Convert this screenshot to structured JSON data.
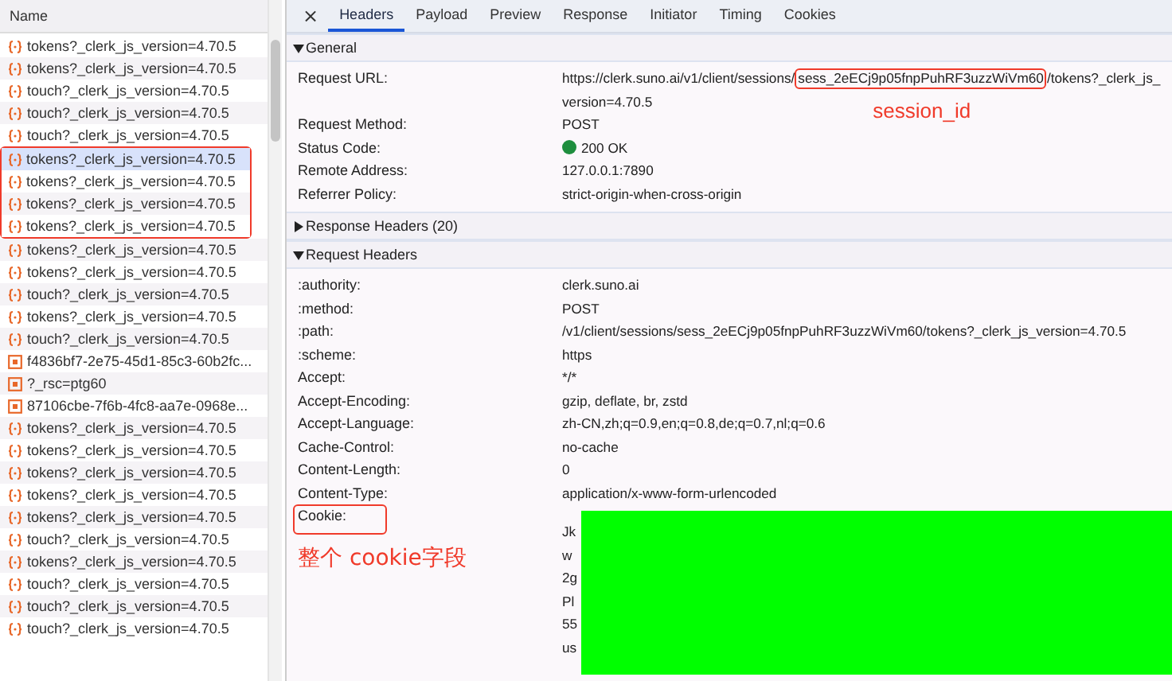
{
  "requests": {
    "column": "Name",
    "items": [
      {
        "name": "tokens?_clerk_js_version=4.70.5",
        "kind": "fetch",
        "selected": false,
        "boxed": false
      },
      {
        "name": "tokens?_clerk_js_version=4.70.5",
        "kind": "fetch",
        "selected": false,
        "boxed": false
      },
      {
        "name": "touch?_clerk_js_version=4.70.5",
        "kind": "fetch",
        "selected": false,
        "boxed": false
      },
      {
        "name": "touch?_clerk_js_version=4.70.5",
        "kind": "fetch",
        "selected": false,
        "boxed": false
      },
      {
        "name": "touch?_clerk_js_version=4.70.5",
        "kind": "fetch",
        "selected": false,
        "boxed": false
      },
      {
        "name": "tokens?_clerk_js_version=4.70.5",
        "kind": "fetch",
        "selected": true,
        "boxed": true
      },
      {
        "name": "tokens?_clerk_js_version=4.70.5",
        "kind": "fetch",
        "selected": false,
        "boxed": true
      },
      {
        "name": "tokens?_clerk_js_version=4.70.5",
        "kind": "fetch",
        "selected": false,
        "boxed": true
      },
      {
        "name": "tokens?_clerk_js_version=4.70.5",
        "kind": "fetch",
        "selected": false,
        "boxed": true
      },
      {
        "name": "tokens?_clerk_js_version=4.70.5",
        "kind": "fetch",
        "selected": false,
        "boxed": false
      },
      {
        "name": "tokens?_clerk_js_version=4.70.5",
        "kind": "fetch",
        "selected": false,
        "boxed": false
      },
      {
        "name": "touch?_clerk_js_version=4.70.5",
        "kind": "fetch",
        "selected": false,
        "boxed": false
      },
      {
        "name": "tokens?_clerk_js_version=4.70.5",
        "kind": "fetch",
        "selected": false,
        "boxed": false
      },
      {
        "name": "touch?_clerk_js_version=4.70.5",
        "kind": "fetch",
        "selected": false,
        "boxed": false
      },
      {
        "name": "f4836bf7-2e75-45d1-85c3-60b2fc...",
        "kind": "doc",
        "selected": false,
        "boxed": false
      },
      {
        "name": "?_rsc=ptg60",
        "kind": "doc",
        "selected": false,
        "boxed": false
      },
      {
        "name": "87106cbe-7f6b-4fc8-aa7e-0968e...",
        "kind": "doc",
        "selected": false,
        "boxed": false
      },
      {
        "name": "tokens?_clerk_js_version=4.70.5",
        "kind": "fetch",
        "selected": false,
        "boxed": false
      },
      {
        "name": "tokens?_clerk_js_version=4.70.5",
        "kind": "fetch",
        "selected": false,
        "boxed": false
      },
      {
        "name": "tokens?_clerk_js_version=4.70.5",
        "kind": "fetch",
        "selected": false,
        "boxed": false
      },
      {
        "name": "tokens?_clerk_js_version=4.70.5",
        "kind": "fetch",
        "selected": false,
        "boxed": false
      },
      {
        "name": "tokens?_clerk_js_version=4.70.5",
        "kind": "fetch",
        "selected": false,
        "boxed": false
      },
      {
        "name": "touch?_clerk_js_version=4.70.5",
        "kind": "fetch",
        "selected": false,
        "boxed": false
      },
      {
        "name": "tokens?_clerk_js_version=4.70.5",
        "kind": "fetch",
        "selected": false,
        "boxed": false
      },
      {
        "name": "touch?_clerk_js_version=4.70.5",
        "kind": "fetch",
        "selected": false,
        "boxed": false
      },
      {
        "name": "touch?_clerk_js_version=4.70.5",
        "kind": "fetch",
        "selected": false,
        "boxed": false
      },
      {
        "name": "touch?_clerk_js_version=4.70.5",
        "kind": "fetch",
        "selected": false,
        "boxed": false
      }
    ]
  },
  "close_button": "×",
  "tabs": [
    {
      "label": "Headers",
      "selected": true
    },
    {
      "label": "Payload",
      "selected": false
    },
    {
      "label": "Preview",
      "selected": false
    },
    {
      "label": "Response",
      "selected": false
    },
    {
      "label": "Initiator",
      "selected": false
    },
    {
      "label": "Timing",
      "selected": false
    },
    {
      "label": "Cookies",
      "selected": false
    }
  ],
  "sections": [
    {
      "title": "General",
      "expanded": true,
      "rows": [
        {
          "key": "Request URL:",
          "value_parts": [
            {
              "text": "https://clerk.suno.ai/v1/client/sessions/"
            },
            {
              "text": "sess_2eECj9p05fnpPuhRF3uzzWiVm60",
              "boxed": true,
              "note": "session_id"
            },
            {
              "text": "/tokens?_clerk_js_version=4.70.5"
            }
          ]
        },
        {
          "key": "Request Method:",
          "value": "POST"
        },
        {
          "key": "Status Code:",
          "value": "200 OK",
          "kind": "status"
        },
        {
          "key": "Remote Address:",
          "value": "127.0.0.1:7890"
        },
        {
          "key": "Referrer Policy:",
          "value": "strict-origin-when-cross-origin"
        }
      ]
    },
    {
      "title": "Response Headers (20)",
      "expanded": false
    },
    {
      "title": "Request Headers",
      "expanded": true,
      "rows": [
        {
          "key": ":authority:",
          "value": "clerk.suno.ai"
        },
        {
          "key": ":method:",
          "value": "POST"
        },
        {
          "key": ":path:",
          "value": "/v1/client/sessions/sess_2eECj9p05fnpPuhRF3uzzWiVm60/tokens?_clerk_js_version=4.70.5"
        },
        {
          "key": ":scheme:",
          "value": "https"
        },
        {
          "key": "Accept:",
          "value": "*/*"
        },
        {
          "key": "Accept-Encoding:",
          "value": "gzip, deflate, br, zstd"
        },
        {
          "key": "Accept-Language:",
          "value": "zh-CN,zh;q=0.9,en;q=0.8,de;q=0.7,nl;q=0.6"
        },
        {
          "key": "Cache-Control:",
          "value": "no-cache"
        },
        {
          "key": "Content-Length:",
          "value": "0"
        },
        {
          "key": "Content-Type:",
          "value": "application/x-www-form-urlencoded"
        },
        {
          "key": "Cookie:",
          "key_boxed": true,
          "note": "整个 cookie字段",
          "value_lines": [
            "Jk",
            "w",
            "2g",
            "Pl",
            "55",
            "us"
          ],
          "redacted": true
        }
      ]
    }
  ]
}
